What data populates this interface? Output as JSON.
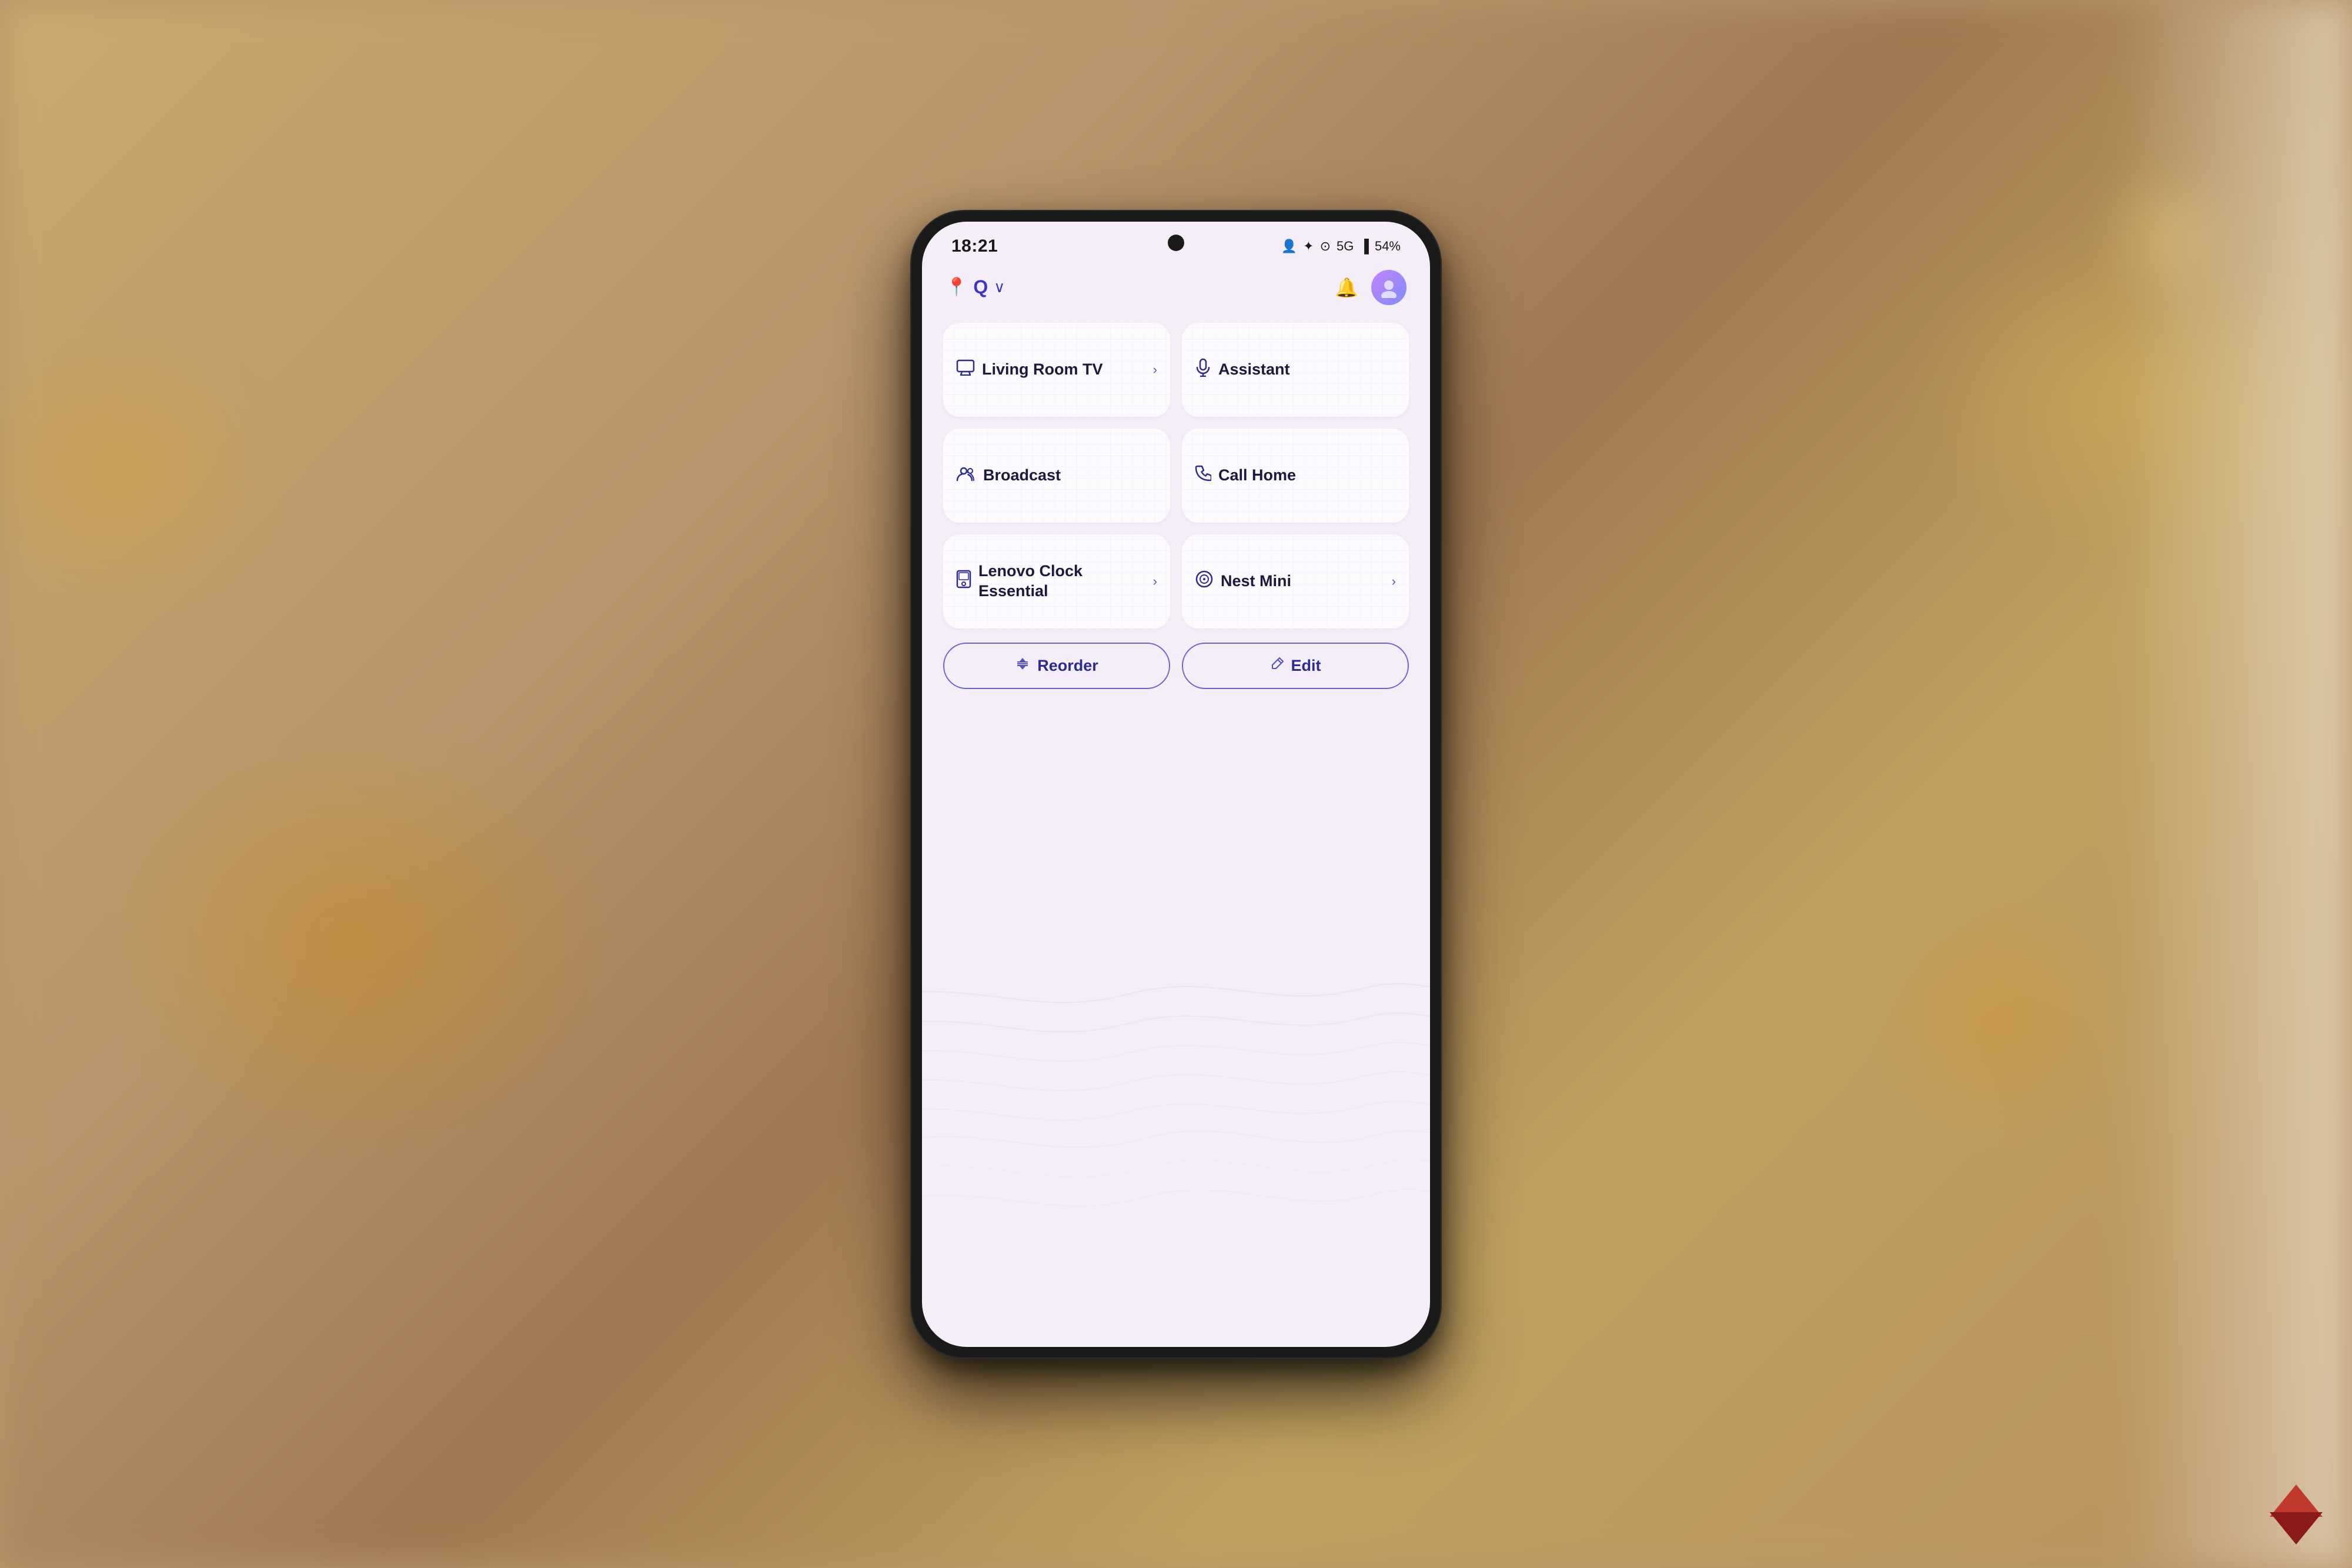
{
  "background": {
    "color": "#b8956a"
  },
  "phone": {
    "status_bar": {
      "time": "18:21",
      "battery_percent": "54%",
      "network": "5G",
      "icons": [
        "person-add",
        "bluetooth",
        "signal",
        "battery"
      ]
    },
    "header": {
      "location_label": "Q",
      "dropdown_shown": true,
      "bell_icon": "bell",
      "avatar_initial": "👤"
    },
    "tiles": [
      {
        "id": "living-room-tv",
        "icon": "tv",
        "icon_char": "🖥",
        "label": "Living Room TV",
        "has_chevron": true
      },
      {
        "id": "assistant",
        "icon": "mic",
        "icon_char": "🎙",
        "label": "Assistant",
        "has_chevron": false
      },
      {
        "id": "broadcast",
        "icon": "broadcast",
        "icon_char": "👥",
        "label": "Broadcast",
        "has_chevron": false
      },
      {
        "id": "call-home",
        "icon": "phone",
        "icon_char": "📞",
        "label": "Call Home",
        "has_chevron": false
      },
      {
        "id": "lenovo-clock",
        "icon": "clock",
        "icon_char": "⏰",
        "label": "Lenovo Clock Essential",
        "has_chevron": true
      },
      {
        "id": "nest-mini",
        "icon": "nest",
        "icon_char": "🔊",
        "label": "Nest Mini",
        "has_chevron": true
      }
    ],
    "actions": [
      {
        "id": "reorder",
        "icon": "↕",
        "label": "Reorder"
      },
      {
        "id": "edit",
        "icon": "✏",
        "label": "Edit"
      }
    ]
  }
}
